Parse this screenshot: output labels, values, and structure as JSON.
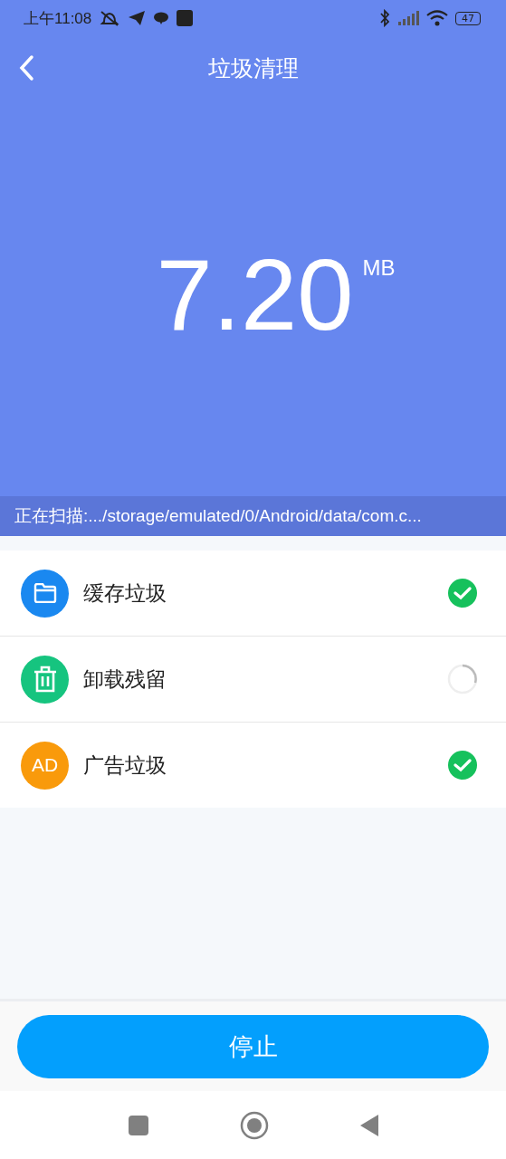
{
  "status_bar": {
    "time": "上午11:08",
    "battery": "47"
  },
  "header": {
    "title": "垃圾清理"
  },
  "total": {
    "value": "7.20",
    "unit": "MB"
  },
  "scan_path": "正在扫描:.../storage/emulated/0/Android/data/com.c...",
  "items": [
    {
      "kind": "folder",
      "label": "缓存垃圾",
      "done": true
    },
    {
      "kind": "trash",
      "label": "卸载残留",
      "done": false
    },
    {
      "kind": "ad",
      "icon_text": "AD",
      "label": "广告垃圾",
      "done": true
    }
  ],
  "stop_button": "停止"
}
